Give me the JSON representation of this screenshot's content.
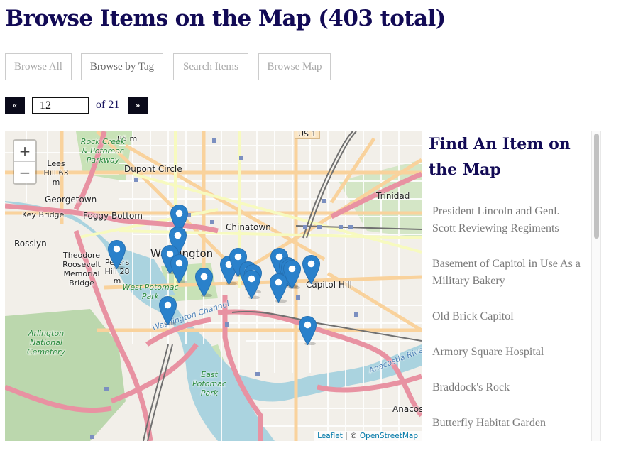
{
  "page": {
    "title": "Browse Items on the Map (403 total)"
  },
  "tabs": [
    {
      "label": "Browse All",
      "emphasis": false
    },
    {
      "label": "Browse by Tag",
      "emphasis": true
    },
    {
      "label": "Search Items",
      "emphasis": false
    },
    {
      "label": "Browse Map",
      "emphasis": false
    }
  ],
  "pagination": {
    "prev_label": "«",
    "next_label": "»",
    "current_page": "12",
    "of_label": "of 21"
  },
  "map": {
    "zoom_in_label": "+",
    "zoom_out_label": "−",
    "attribution": {
      "leaflet": "Leaflet",
      "separator": " | © ",
      "osm": "OpenStreetMap"
    },
    "marker_color": "#2a81cb",
    "place_labels": [
      {
        "text": "Dupont Circle",
        "style": "normal"
      },
      {
        "text": "Georgetown",
        "style": "normal"
      },
      {
        "text": "Foggy Bottom",
        "style": "normal"
      },
      {
        "text": "Key Bridge",
        "style": "small"
      },
      {
        "text": "Rosslyn",
        "style": "normal"
      },
      {
        "text": "Chinatown",
        "style": "normal"
      },
      {
        "text": "Washington",
        "style": "big"
      },
      {
        "text": "Trinidad",
        "style": "normal"
      },
      {
        "text": "Capitol Hill",
        "style": "normal"
      },
      {
        "text": "Anacostia",
        "style": "normal"
      },
      {
        "text": "Theodore Roosevelt Memorial Bridge",
        "style": "small"
      },
      {
        "text": "Peters Hill 28 m",
        "style": "small"
      },
      {
        "text": "Lees Hill 63 m",
        "style": "small"
      },
      {
        "text": "85 m",
        "style": "small"
      },
      {
        "text": "Rock Creek & Potomac Parkway",
        "style": "green"
      },
      {
        "text": "West Potomac Park",
        "style": "green"
      },
      {
        "text": "East Potomac Park",
        "style": "green"
      },
      {
        "text": "Arlington National Cemetery",
        "style": "green"
      },
      {
        "text": "Washington Channel",
        "style": "water"
      },
      {
        "text": "Anacostia River",
        "style": "water"
      },
      {
        "text": "US 1",
        "style": "small"
      }
    ]
  },
  "sidebar": {
    "title": "Find An Item on the Map",
    "items": [
      "President Lincoln and Genl. Scott Reviewing Regiments",
      "Basement of Capitol in Use As a Military Bakery",
      "Old Brick Capitol",
      "Armory Square Hospital",
      "Braddock's Rock",
      "Butterfly Habitat Garden"
    ]
  },
  "colors": {
    "title": "#120a55",
    "list_text": "#7a7a7a",
    "tab_text": "#a8a8a8"
  }
}
